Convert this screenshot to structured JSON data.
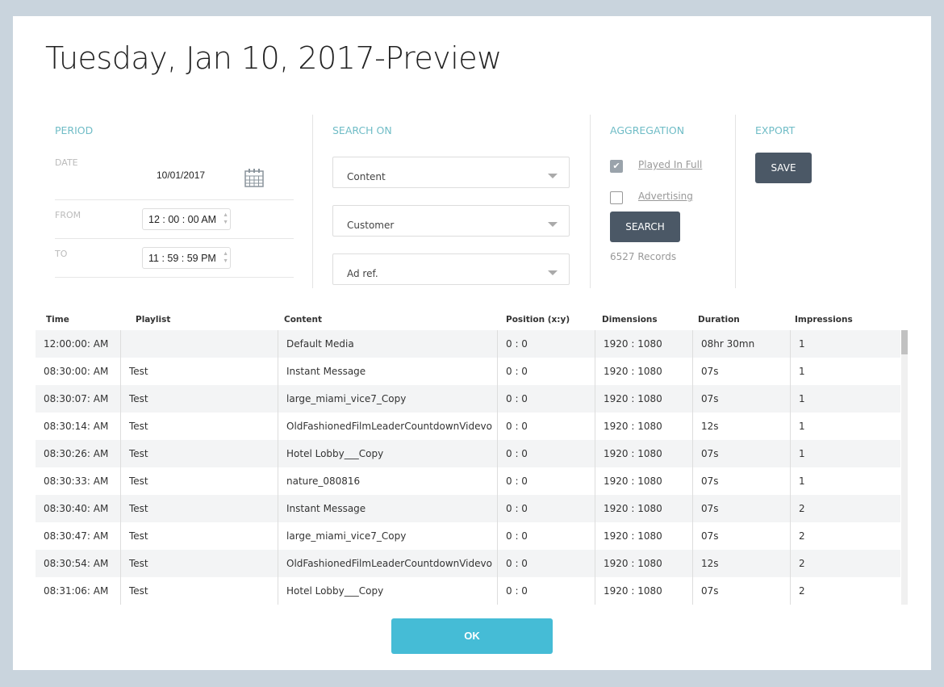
{
  "title": "Tuesday, Jan 10, 2017-Preview",
  "period": {
    "heading": "PERIOD",
    "date_label": "DATE",
    "date_value": "10/01/2017",
    "from_label": "FROM",
    "from_value": "12 : 00 : 00 AM",
    "to_label": "TO",
    "to_value": "11 : 59 : 59 PM"
  },
  "search_on": {
    "heading": "SEARCH ON",
    "selects": [
      "Content",
      "Customer",
      "Ad ref."
    ]
  },
  "aggregation": {
    "heading": "AGGREGATION",
    "played_in_full": "Played In Full",
    "played_in_full_checked": true,
    "advertising": "Advertising",
    "advertising_checked": false,
    "search_label": "SEARCH",
    "records": "6527 Records"
  },
  "export": {
    "heading": "EXPORT",
    "save_label": "SAVE"
  },
  "table": {
    "columns": [
      "Time",
      "Playlist",
      "Content",
      "Position (x:y)",
      "Dimensions",
      "Duration",
      "Impressions"
    ],
    "rows": [
      [
        "12:00:00: AM",
        "",
        "Default Media",
        "0 : 0",
        "1920 : 1080",
        "08hr 30mn",
        "1"
      ],
      [
        "08:30:00: AM",
        "Test",
        "Instant Message",
        "0 : 0",
        "1920 : 1080",
        "07s",
        "1"
      ],
      [
        "08:30:07: AM",
        "Test",
        "large_miami_vice7_Copy",
        "0 : 0",
        "1920 : 1080",
        "07s",
        "1"
      ],
      [
        "08:30:14: AM",
        "Test",
        "OldFashionedFilmLeaderCountdownVidevo",
        "0 : 0",
        "1920 : 1080",
        "12s",
        "1"
      ],
      [
        "08:30:26: AM",
        "Test",
        "Hotel Lobby___Copy",
        "0 : 0",
        "1920 : 1080",
        "07s",
        "1"
      ],
      [
        "08:30:33: AM",
        "Test",
        "nature_080816",
        "0 : 0",
        "1920 : 1080",
        "07s",
        "1"
      ],
      [
        "08:30:40: AM",
        "Test",
        "Instant Message",
        "0 : 0",
        "1920 : 1080",
        "07s",
        "2"
      ],
      [
        "08:30:47: AM",
        "Test",
        "large_miami_vice7_Copy",
        "0 : 0",
        "1920 : 1080",
        "07s",
        "2"
      ],
      [
        "08:30:54: AM",
        "Test",
        "OldFashionedFilmLeaderCountdownVidevo",
        "0 : 0",
        "1920 : 1080",
        "12s",
        "2"
      ],
      [
        "08:31:06: AM",
        "Test",
        "Hotel Lobby___Copy",
        "0 : 0",
        "1920 : 1080",
        "07s",
        "2"
      ]
    ]
  },
  "ok_label": "OK"
}
